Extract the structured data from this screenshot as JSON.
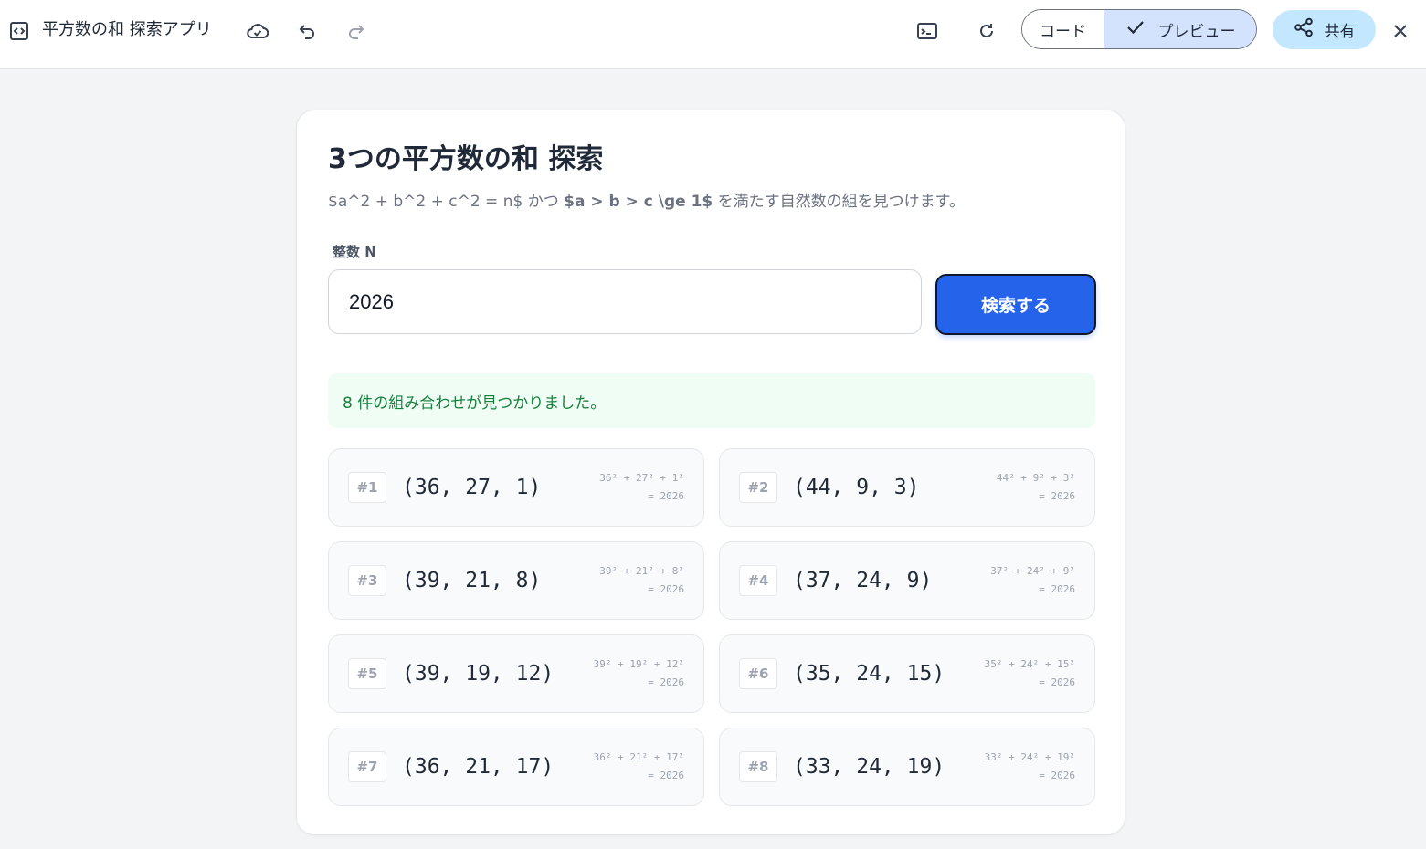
{
  "topbar": {
    "app_title": "平方数の和 探索アプリ",
    "code_label": "コード",
    "preview_label": "プレビュー",
    "share_label": "共有"
  },
  "card": {
    "title": "3つの平方数の和 探索",
    "desc_pre": "$a^2 + b^2 + c^2 = n$ かつ ",
    "desc_bold": "$a > b > c \\ge 1$",
    "desc_post": " を満たす自然数の組を見つけます。",
    "field_label": "整数 N",
    "input_value": "2026",
    "search_label": "検索する",
    "status": "8 件の組み合わせが見つかりました。"
  },
  "results": [
    {
      "rank": "#1",
      "triple": "(36, 27, 1)",
      "eq": "36² + 27² + 1²",
      "total": "= 2026"
    },
    {
      "rank": "#2",
      "triple": "(44, 9, 3)",
      "eq": "44² + 9² + 3²",
      "total": "= 2026"
    },
    {
      "rank": "#3",
      "triple": "(39, 21, 8)",
      "eq": "39² + 21² + 8²",
      "total": "= 2026"
    },
    {
      "rank": "#4",
      "triple": "(37, 24, 9)",
      "eq": "37² + 24² + 9²",
      "total": "= 2026"
    },
    {
      "rank": "#5",
      "triple": "(39, 19, 12)",
      "eq": "39² + 19² + 12²",
      "total": "= 2026"
    },
    {
      "rank": "#6",
      "triple": "(35, 24, 15)",
      "eq": "35² + 24² + 15²",
      "total": "= 2026"
    },
    {
      "rank": "#7",
      "triple": "(36, 21, 17)",
      "eq": "36² + 21² + 17²",
      "total": "= 2026"
    },
    {
      "rank": "#8",
      "triple": "(33, 24, 19)",
      "eq": "33² + 24² + 19²",
      "total": "= 2026"
    }
  ],
  "icons": {
    "app": "code-bracket-icon",
    "cloud": "cloud-check-icon",
    "undo": "undo-icon",
    "redo": "redo-icon",
    "terminal": "terminal-icon",
    "refresh": "refresh-icon",
    "check": "check-icon",
    "share": "share-icon",
    "close": "close-icon"
  },
  "colors": {
    "accent": "#2563eb",
    "preview_bg": "#d3e3fd",
    "share_bg": "#c2e7ff",
    "success_bg": "#f0fdf4",
    "success_text": "#15803d"
  }
}
